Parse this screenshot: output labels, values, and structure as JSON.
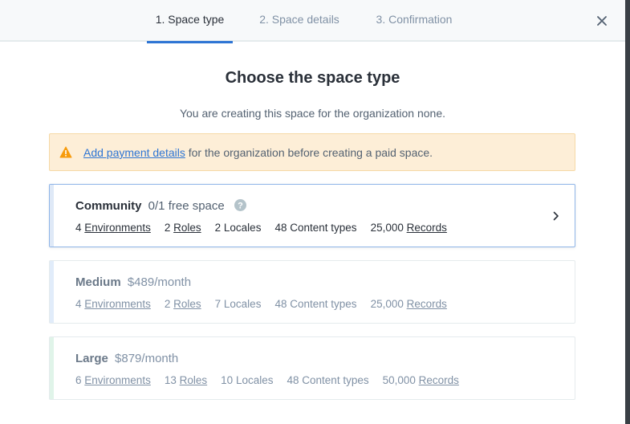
{
  "tabs": [
    {
      "label": "1. Space type"
    },
    {
      "label": "2. Space details"
    },
    {
      "label": "3. Confirmation"
    }
  ],
  "title": "Choose the space type",
  "subtitle": "You are creating this space for the organization none.",
  "warning": {
    "link": "Add payment details",
    "text": " for the organization before creating a paid space."
  },
  "plans": [
    {
      "name": "Community",
      "price": "0/1 free space",
      "features": [
        {
          "count": "4",
          "label": "Environments",
          "linked": true
        },
        {
          "count": "2",
          "label": "Roles",
          "linked": true
        },
        {
          "count": "2",
          "label": "Locales",
          "linked": false
        },
        {
          "count": "48",
          "label": "Content types",
          "linked": false
        },
        {
          "count": "25,000",
          "label": "Records",
          "linked": true
        }
      ]
    },
    {
      "name": "Medium",
      "price": "$489/month",
      "features": [
        {
          "count": "4",
          "label": "Environments",
          "linked": true
        },
        {
          "count": "2",
          "label": "Roles",
          "linked": true
        },
        {
          "count": "7",
          "label": "Locales",
          "linked": false
        },
        {
          "count": "48",
          "label": "Content types",
          "linked": false
        },
        {
          "count": "25,000",
          "label": "Records",
          "linked": true
        }
      ]
    },
    {
      "name": "Large",
      "price": "$879/month",
      "features": [
        {
          "count": "6",
          "label": "Environments",
          "linked": true
        },
        {
          "count": "13",
          "label": "Roles",
          "linked": true
        },
        {
          "count": "10",
          "label": "Locales",
          "linked": false
        },
        {
          "count": "48",
          "label": "Content types",
          "linked": false
        },
        {
          "count": "50,000",
          "label": "Records",
          "linked": true
        }
      ]
    }
  ],
  "colors": {
    "accent": "#2e75d4",
    "warning_bg": "#fdeed7",
    "warning_icon": "#f79b0c"
  },
  "icons": {
    "close": "close-icon",
    "warning": "warning-icon",
    "help": "help-icon",
    "chevron": "chevron-right-icon"
  }
}
